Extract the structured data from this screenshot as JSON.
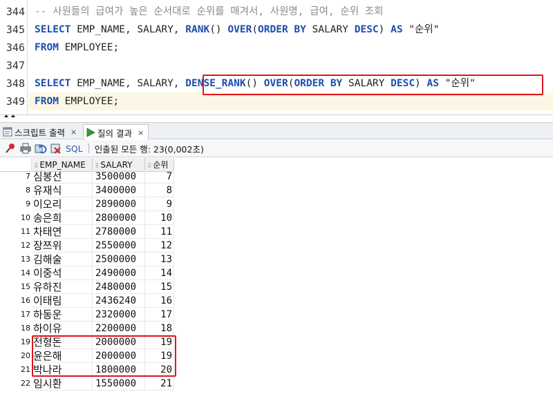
{
  "editor": {
    "lines": [
      {
        "num": "344",
        "segments": [
          {
            "t": "-- 사원들의 급여가 높은 순서대로 순위를 매겨서, 사원명, 급여, 순위 조회",
            "c": "cm"
          }
        ]
      },
      {
        "num": "345",
        "segments": [
          {
            "t": "SELECT",
            "c": "kw"
          },
          {
            "t": " EMP_NAME, SALARY, ",
            "c": ""
          },
          {
            "t": "RANK",
            "c": "kw"
          },
          {
            "t": "() ",
            "c": ""
          },
          {
            "t": "OVER",
            "c": "kw"
          },
          {
            "t": "(",
            "c": ""
          },
          {
            "t": "ORDER BY",
            "c": "kw"
          },
          {
            "t": " SALARY ",
            "c": ""
          },
          {
            "t": "DESC",
            "c": "kw"
          },
          {
            "t": ") ",
            "c": ""
          },
          {
            "t": "AS",
            "c": "kw"
          },
          {
            "t": " \"순위\"",
            "c": "str"
          }
        ]
      },
      {
        "num": "346",
        "segments": [
          {
            "t": "FROM",
            "c": "kw"
          },
          {
            "t": " EMPLOYEE;",
            "c": ""
          }
        ]
      },
      {
        "num": "347",
        "segments": []
      },
      {
        "num": "348",
        "segments": [
          {
            "t": "SELECT",
            "c": "kw"
          },
          {
            "t": " EMP_NAME, SALARY, ",
            "c": ""
          },
          {
            "t": "DENSE_RANK",
            "c": "kw"
          },
          {
            "t": "() ",
            "c": ""
          },
          {
            "t": "OVER",
            "c": "kw"
          },
          {
            "t": "(",
            "c": ""
          },
          {
            "t": "ORDER BY",
            "c": "kw"
          },
          {
            "t": " SALARY ",
            "c": ""
          },
          {
            "t": "DESC",
            "c": "kw"
          },
          {
            "t": ") ",
            "c": ""
          },
          {
            "t": "AS",
            "c": "kw"
          },
          {
            "t": " \"순위\"",
            "c": "str"
          }
        ]
      },
      {
        "num": "349",
        "segments": [
          {
            "t": "FROM",
            "c": "kw"
          },
          {
            "t": " EMPLOYEE;",
            "c": ""
          }
        ]
      }
    ]
  },
  "tabs": [
    {
      "label": "스크립트 출력",
      "close": "×",
      "icon": "script-output-icon"
    },
    {
      "label": "질의 결과",
      "close": "×",
      "icon": "run-result-icon",
      "active": true
    }
  ],
  "toolbar": {
    "sql_label": "SQL",
    "status": "인출된 모든 행: 23(0,002초)"
  },
  "grid": {
    "columns": [
      "EMP_NAME",
      "SALARY",
      "순위"
    ],
    "rows": [
      {
        "n": "7",
        "name": "심봉선",
        "salary": "3500000",
        "rank": "7"
      },
      {
        "n": "8",
        "name": "유재식",
        "salary": "3400000",
        "rank": "8"
      },
      {
        "n": "9",
        "name": "이오리",
        "salary": "2890000",
        "rank": "9"
      },
      {
        "n": "10",
        "name": "송은희",
        "salary": "2800000",
        "rank": "10"
      },
      {
        "n": "11",
        "name": "차태연",
        "salary": "2780000",
        "rank": "11"
      },
      {
        "n": "12",
        "name": "장쯔위",
        "salary": "2550000",
        "rank": "12"
      },
      {
        "n": "13",
        "name": "김해술",
        "salary": "2500000",
        "rank": "13"
      },
      {
        "n": "14",
        "name": "이중석",
        "salary": "2490000",
        "rank": "14"
      },
      {
        "n": "15",
        "name": "유하진",
        "salary": "2480000",
        "rank": "15"
      },
      {
        "n": "16",
        "name": "이태림",
        "salary": "2436240",
        "rank": "16"
      },
      {
        "n": "17",
        "name": "하동운",
        "salary": "2320000",
        "rank": "17"
      },
      {
        "n": "18",
        "name": "하이유",
        "salary": "2200000",
        "rank": "18"
      },
      {
        "n": "19",
        "name": "전형돈",
        "salary": "2000000",
        "rank": "19"
      },
      {
        "n": "20",
        "name": "윤은해",
        "salary": "2000000",
        "rank": "19"
      },
      {
        "n": "21",
        "name": "박나라",
        "salary": "1800000",
        "rank": "20"
      },
      {
        "n": "22",
        "name": "임시환",
        "salary": "1550000",
        "rank": "21"
      }
    ]
  },
  "colors": {
    "keyword": "#1d4ea8",
    "comment": "#8a8a8a",
    "highlight_border": "#e0141b",
    "current_line": "#fbf7e4"
  }
}
